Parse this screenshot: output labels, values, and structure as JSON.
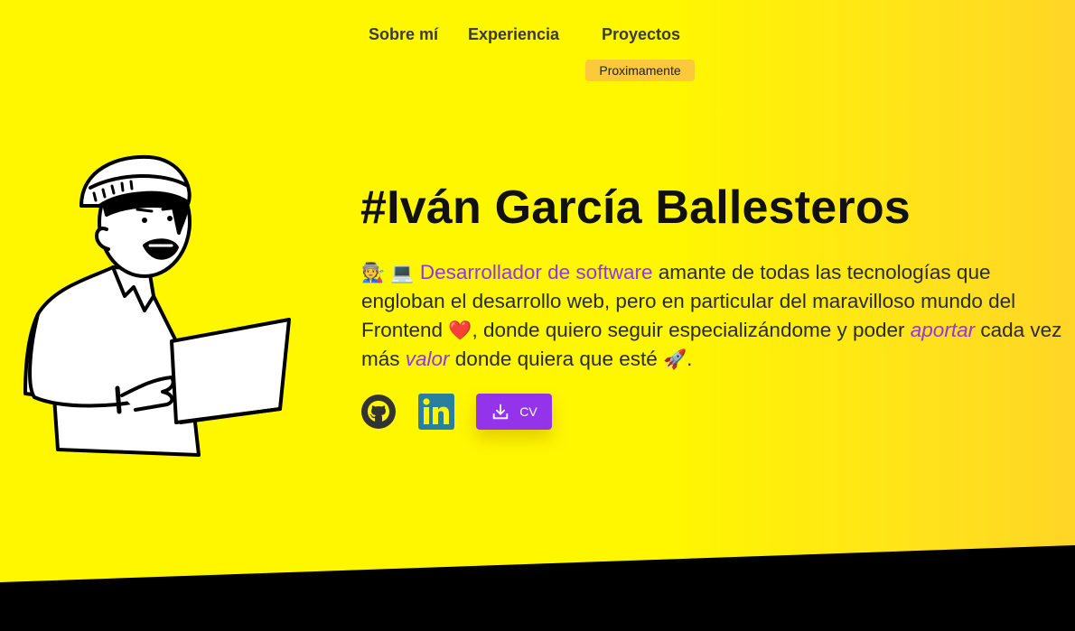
{
  "nav": {
    "about": "Sobre mí",
    "experience": "Experiencia",
    "projects": "Proyectos",
    "projects_badge": "Proximamente"
  },
  "hero": {
    "title": "#Iván García Ballesteros",
    "emoji_worker": "🧑‍🏭",
    "emoji_laptop": "💻",
    "role": "Desarrollador de software",
    "text_1": " amante de todas las tecnologías que engloban el desarrollo web, pero en particular del maravilloso mundo del Frontend ",
    "emoji_heart": "❤️",
    "text_2": ", donde quiero seguir especializándome y poder ",
    "word_aportar": "aportar",
    "text_3": " cada vez más ",
    "word_valor": "valor",
    "text_4": " donde quiera que esté ",
    "emoji_rocket": "🚀",
    "text_5": "."
  },
  "social": {
    "github_icon": "github-icon",
    "linkedin_icon": "linkedin-icon",
    "cv_label": "CV",
    "cv_icon": "download-icon"
  },
  "colors": {
    "background": "#fff700",
    "accent": "#9333ea",
    "badge": "#fbc93a",
    "linkedin": "#2a7f9e"
  }
}
